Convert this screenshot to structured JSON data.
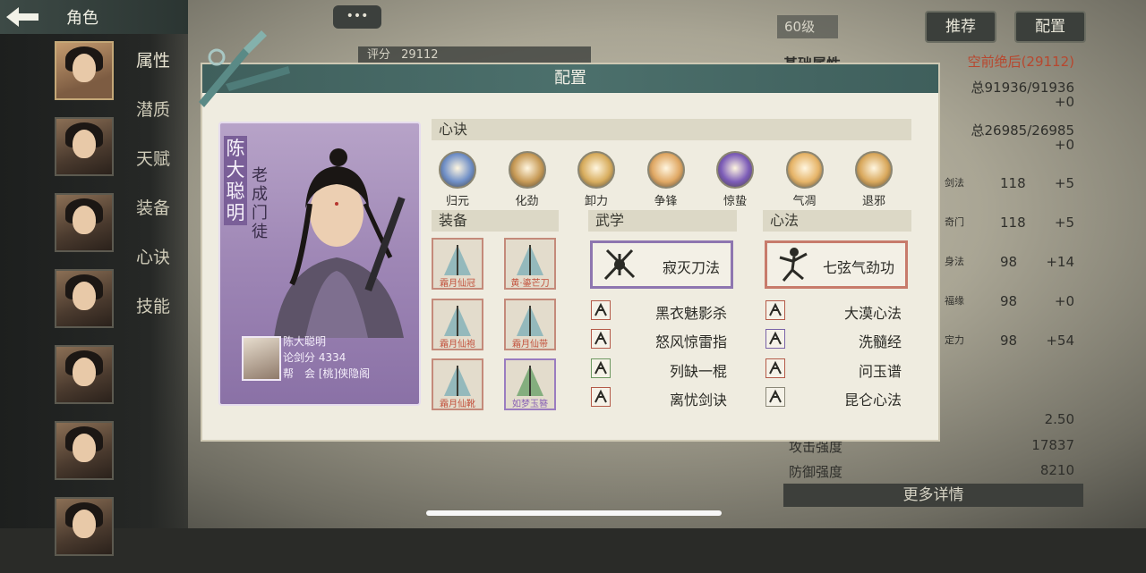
{
  "header": {
    "back_label": "角色"
  },
  "side_menu": [
    "属性",
    "潜质",
    "天赋",
    "装备",
    "心诀",
    "技能"
  ],
  "top": {
    "level": "60级",
    "recommend_label": "推荐",
    "config_label": "配置",
    "chat": "•••",
    "score_label": "评分",
    "score_value": "29112"
  },
  "right_panel": {
    "title": "基础属性",
    "subtitle": "空前绝后(29112)",
    "hp": "总91936/91936",
    "hp_bonus": "+0",
    "mp": "总26985/26985",
    "mp_bonus": "+0",
    "attrs": [
      {
        "name": "剑法",
        "value": "118",
        "bonus": "+5"
      },
      {
        "name": "奇门",
        "value": "118",
        "bonus": "+5"
      },
      {
        "name": "身法",
        "value": "98",
        "bonus": "+14"
      },
      {
        "name": "福缘",
        "value": "98",
        "bonus": "+0"
      },
      {
        "name": "定力",
        "value": "98",
        "bonus": "+54"
      }
    ],
    "stat_rows": [
      {
        "label": "",
        "value": "2.50"
      },
      {
        "label": "攻击强度",
        "value": "17837"
      },
      {
        "label": "防御强度",
        "value": "8210"
      }
    ],
    "more_label": "更多详情"
  },
  "dialog": {
    "title": "配置",
    "character": {
      "name": "陈大聪明",
      "title": "老成门徒",
      "info_name": "陈大聪明",
      "info_score": "论剑分 4334",
      "info_guild": "帮　会 [桃]侠隐阁"
    },
    "xinjue": {
      "label": "心诀",
      "skills": [
        {
          "name": "归元",
          "color": "#6f8fc7"
        },
        {
          "name": "化劲",
          "color": "#c79a56"
        },
        {
          "name": "卸力",
          "color": "#d8ad5e"
        },
        {
          "name": "争锋",
          "color": "#e0a864"
        },
        {
          "name": "惊蛰",
          "color": "#7c5cb8"
        },
        {
          "name": "气凋",
          "color": "#e6b468"
        },
        {
          "name": "退邪",
          "color": "#d9a85c"
        }
      ]
    },
    "equipment": {
      "label": "装备",
      "items": [
        {
          "label": "霜月仙冠",
          "rarity": "red"
        },
        {
          "label": "黄·鎏芒刀",
          "rarity": "red"
        },
        {
          "label": "霜月仙袍",
          "rarity": "red"
        },
        {
          "label": "霜月仙带",
          "rarity": "red"
        },
        {
          "label": "霜月仙靴",
          "rarity": "red"
        },
        {
          "label": "如梦玉簪",
          "rarity": "purple"
        }
      ]
    },
    "wuxue": {
      "label": "武学",
      "main": "寂灭刀法",
      "subs": [
        {
          "name": "黑衣魅影杀",
          "frame": "red"
        },
        {
          "name": "怒风惊雷指",
          "frame": "red"
        },
        {
          "name": "列缺一棍",
          "frame": "green"
        },
        {
          "name": "离忧剑诀",
          "frame": "red"
        }
      ]
    },
    "xinfa": {
      "label": "心法",
      "main": "七弦气劲功",
      "subs": [
        {
          "name": "大漠心法",
          "frame": "red"
        },
        {
          "name": "洗髓经",
          "frame": "purple"
        },
        {
          "name": "问玉谱",
          "frame": "red"
        },
        {
          "name": "昆仑心法",
          "frame": "gray"
        }
      ]
    }
  }
}
